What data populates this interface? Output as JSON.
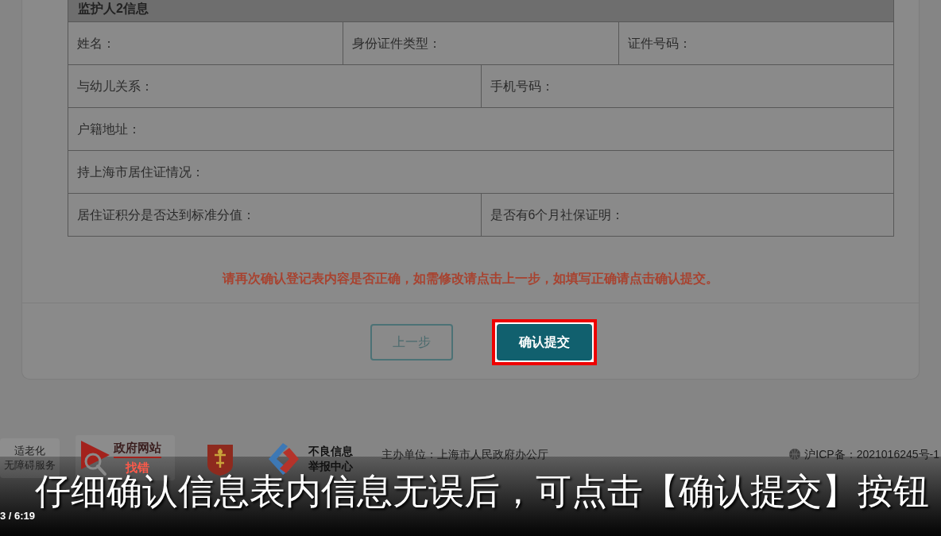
{
  "section": {
    "title": "监护人2信息"
  },
  "rows": [
    [
      {
        "label": "姓名："
      },
      {
        "label": "身份证件类型："
      },
      {
        "label": "证件号码："
      }
    ],
    [
      {
        "label": "与幼儿关系："
      },
      {
        "label": "手机号码："
      }
    ],
    [
      {
        "label": "户籍地址："
      }
    ],
    [
      {
        "label": "持上海市居住证情况："
      }
    ],
    [
      {
        "label": "居住证积分是否达到标准分值："
      },
      {
        "label": "是否有6个月社保证明："
      }
    ]
  ],
  "notice": "请再次确认登记表内容是否正确，如需修改请点击上一步，如填写正确请点击确认提交。",
  "buttons": [
    {
      "label": "上一步",
      "kind": "outline",
      "highlighted": false
    },
    {
      "label": "确认提交",
      "kind": "primary",
      "highlighted": true
    }
  ],
  "footer": {
    "badges": [
      {
        "kind": "accessibility",
        "lines": [
          "适老化",
          "无障碍服务"
        ]
      },
      {
        "kind": "error_report",
        "title": "政府网站",
        "subtitle": "找错"
      },
      {
        "kind": "emblem"
      },
      {
        "kind": "report_center",
        "lines": [
          "不良信息",
          "举报中心"
        ]
      }
    ],
    "sponsor": "主办单位：上海市人民政府办公厅",
    "icp": "沪ICP备：2021016245号-1"
  },
  "video": {
    "subtitle": "仔细确认信息表内信息无误后，可点击【确认提交】按钮",
    "time": "3 / 6:19"
  }
}
